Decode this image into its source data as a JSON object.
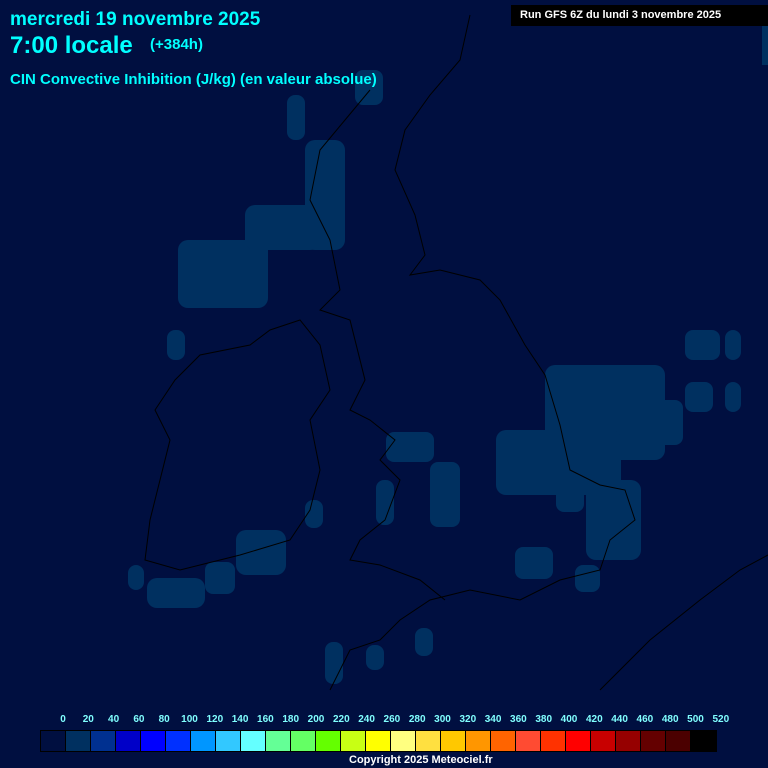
{
  "header": {
    "date": "mercredi 19 novembre 2025",
    "time": "7:00 locale",
    "lead": "(+384h)",
    "parameter": "CIN Convective Inhibition (J/kg) (en valeur absolue)",
    "run": "Run GFS 6Z du lundi 3 novembre 2025"
  },
  "legend": {
    "labels": [
      "0",
      "20",
      "40",
      "60",
      "80",
      "100",
      "120",
      "140",
      "160",
      "180",
      "200",
      "220",
      "240",
      "260",
      "280",
      "300",
      "320",
      "340",
      "360",
      "380",
      "400",
      "420",
      "440",
      "460",
      "480",
      "500",
      "520"
    ],
    "colors": [
      "#000f40",
      "#003060",
      "#003090",
      "#0000c8",
      "#0000ff",
      "#0030ff",
      "#0096ff",
      "#32c8ff",
      "#64ffff",
      "#64ff96",
      "#64ff64",
      "#64ff00",
      "#c8ff14",
      "#ffff00",
      "#ffff80",
      "#ffe040",
      "#ffc800",
      "#ff9600",
      "#ff6400",
      "#ff4b32",
      "#ff3200",
      "#ff0000",
      "#c80000",
      "#960000",
      "#640000",
      "#4b0000",
      "#000000"
    ]
  },
  "colors": {
    "background": "#000f40",
    "cin_low": "#003060",
    "coast": "#000000"
  },
  "copyright": "Copyright 2025 Meteociel.fr"
}
